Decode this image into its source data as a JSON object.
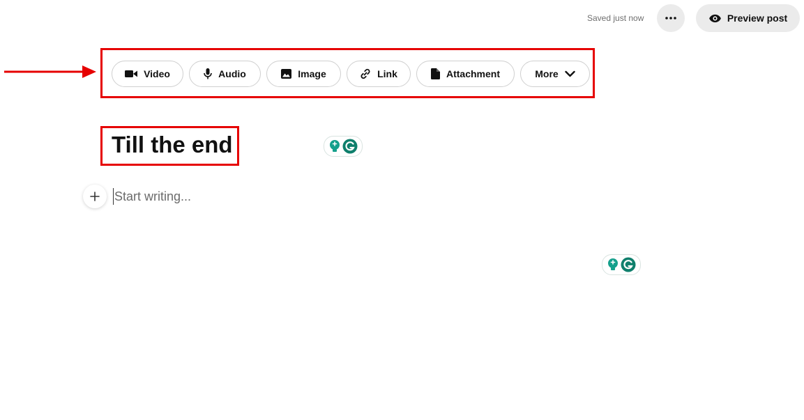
{
  "header": {
    "saved_status": "Saved just now",
    "more_icon": "ellipsis-icon",
    "preview_label": "Preview post",
    "preview_icon": "eye-icon"
  },
  "toolbar": {
    "items": [
      {
        "label": "Video",
        "icon": "video-camera-icon"
      },
      {
        "label": "Audio",
        "icon": "microphone-icon"
      },
      {
        "label": "Image",
        "icon": "image-icon"
      },
      {
        "label": "Link",
        "icon": "link-icon"
      },
      {
        "label": "Attachment",
        "icon": "file-icon"
      },
      {
        "label": "More",
        "icon": "chevron-down-icon"
      }
    ]
  },
  "editor": {
    "title": "Till the end",
    "body_placeholder": "Start writing...",
    "add_block_icon": "plus-icon"
  },
  "colors": {
    "annotation": "#e60000",
    "button_bg": "#ebebeb",
    "grammarly_green": "#15a08c",
    "grammarly_dark": "#0f7f6c"
  }
}
